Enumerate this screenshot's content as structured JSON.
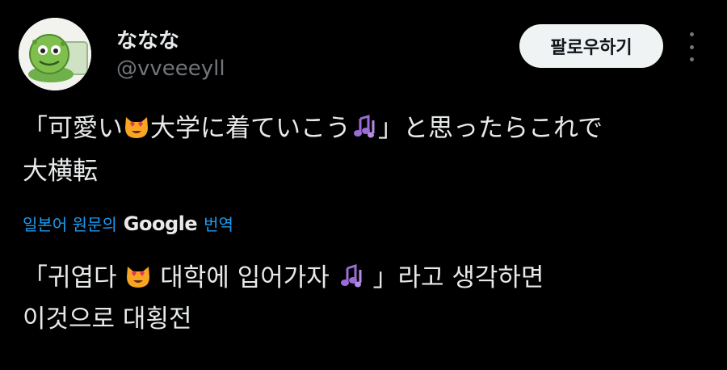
{
  "author": {
    "display_name": "ななな",
    "handle": "@vveeeyll"
  },
  "follow_label": "팔로우하기",
  "tweet": {
    "line1_a": "「可愛い",
    "line1_b": "大学に着ていこう",
    "line1_c": "」と思ったらこれで",
    "line2": "大横転"
  },
  "translation_bar": {
    "prefix": "일본어 원문의",
    "google": "Google",
    "suffix": "번역"
  },
  "translation": {
    "line1_a": "「귀엽다 ",
    "line1_b": " 대학에 입어가자 ",
    "line1_c": " 」라고 생각하면",
    "line2": "이것으로 대횡전"
  },
  "icons": {
    "emoji_cat": "heart-eyes-cat-emoji-icon",
    "emoji_notes": "music-notes-emoji-icon",
    "more": "more-options-icon"
  },
  "colors": {
    "background": "#000000",
    "text": "#e7e9ea",
    "muted": "#71767b",
    "link": "#1d9bf0",
    "button_bg": "#eff3f4"
  }
}
